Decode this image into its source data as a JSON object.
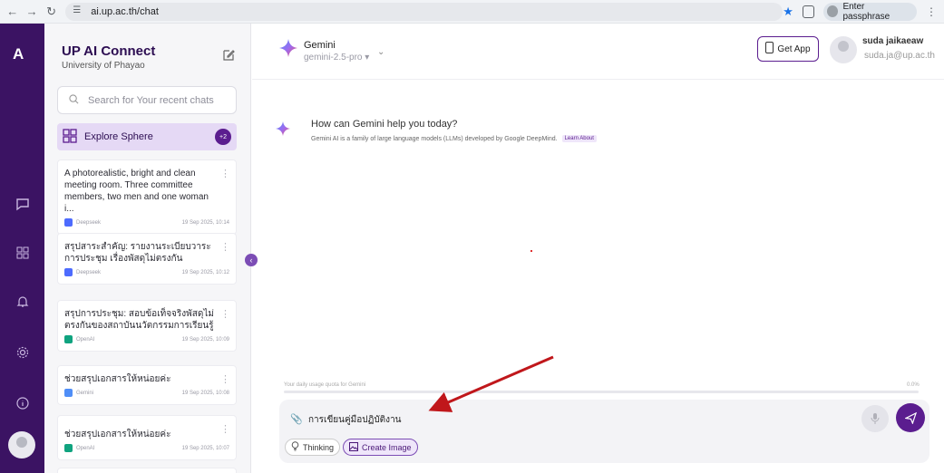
{
  "browser": {
    "url": "ai.up.ac.th/chat",
    "profile_label": "Enter passphrase"
  },
  "rail": {
    "logo": "A"
  },
  "sidebar": {
    "title": "UP AI Connect",
    "subtitle": "University of Phayao",
    "search_placeholder": "Search for Your recent chats",
    "explore_label": "Explore Sphere",
    "explore_badge": "+2",
    "chats": [
      {
        "title": "A photorealistic, bright and clean meeting room. Three committee members, two men and one woman i...",
        "provider": "Deepseek",
        "date": "19 Sep 2025, 10:14",
        "provider_color": "#4d6bfe"
      },
      {
        "title": "สรุปสาระสำคัญ: รายงานระเบียบวาระการประชุม เรื่องพัสดุไม่ตรงกัน",
        "provider": "Deepseek",
        "date": "19 Sep 2025, 10:12",
        "provider_color": "#4d6bfe"
      },
      {
        "title": "สรุปการประชุม: สอบข้อเท็จจริงพัสดุไม่ตรงกันของสถาบันนวัตกรรมการเรียนรู้",
        "provider": "OpenAI",
        "date": "19 Sep 2025, 10:09",
        "provider_color": "#10a37f"
      },
      {
        "title": "ช่วยสรุปเอกสารให้หน่อยค่ะ",
        "provider": "Gemini",
        "date": "19 Sep 2025, 10:08",
        "provider_color": "#4f8ef7"
      },
      {
        "title": "ช่วยสรุปเอกสารให้หน่อยค่ะ",
        "provider": "OpenAI",
        "date": "19 Sep 2025, 10:07",
        "provider_color": "#10a37f"
      }
    ]
  },
  "header": {
    "model_name": "Gemini",
    "model_version": "gemini-2.5-pro",
    "get_app": "Get App",
    "user_name": "suda jaikaeaw",
    "user_email": "suda.ja@up.ac.th"
  },
  "greeting": {
    "title": "How can Gemini help you today?",
    "subtitle": "Gemini AI is a family of large language models (LLMs) developed by Google DeepMind.",
    "learn_link": "Learn About"
  },
  "quota": {
    "label": "Your daily usage quota for Gemini",
    "percent_text": "0.0%",
    "fraction": 0.0
  },
  "composer": {
    "value": "การเขียนคู่มือปฏิบัติงาน",
    "thinking_label": "Thinking",
    "create_image_label": "Create Image"
  },
  "colors": {
    "brand": "#5b1d8f",
    "rail": "#3b1363",
    "annotation_arrow": "#c0171b"
  }
}
